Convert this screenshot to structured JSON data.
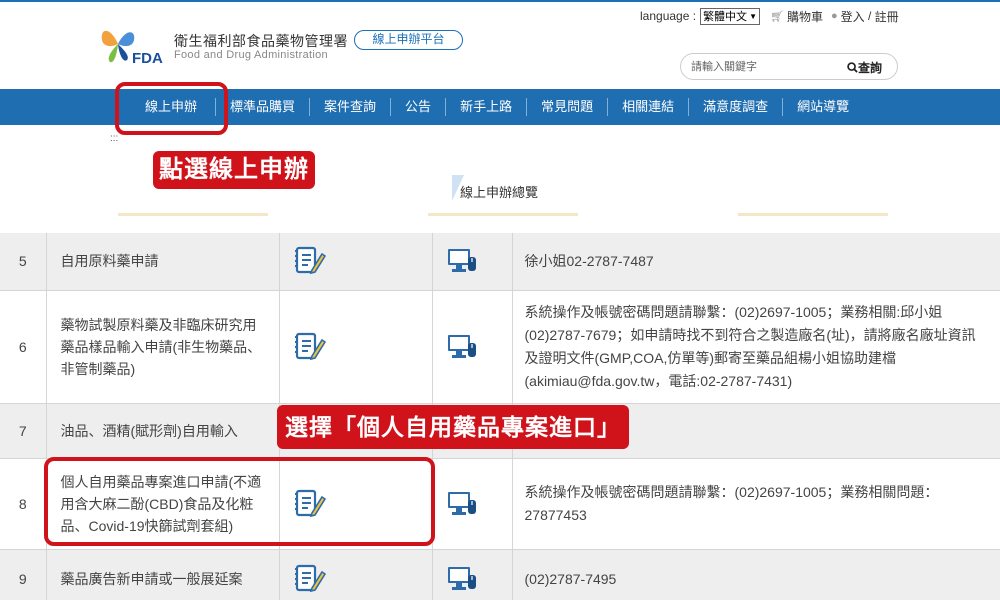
{
  "header": {
    "org_name_cn": "衛生福利部食品藥物管理署",
    "org_name_en": "Food and Drug Administration",
    "logo_text": "FDA",
    "platform_button": "線上申辦平台",
    "language_label": "language :",
    "language_selected": "繁體中文",
    "cart_label": "購物車",
    "login_label": "登入",
    "register_label": "註冊",
    "search_placeholder": "請輸入關鍵字",
    "search_button": "查詢"
  },
  "nav": {
    "items": [
      "線上申辦",
      "標準品購買",
      "案件查詢",
      "公告",
      "新手上路",
      "常見問題",
      "相關連結",
      "滿意度調查",
      "網站導覽"
    ]
  },
  "annotations": {
    "callout_top": "點選線上申辦",
    "callout_mid": "選擇「個人自用藥品專案進口」"
  },
  "breadcrumb": {
    "dots": ":::"
  },
  "section_title": "線上申辦總覽",
  "table": {
    "rows": [
      {
        "num": "5",
        "name": "自用原料藥申請",
        "contact": "徐小姐02-2787-7487",
        "style": "alt"
      },
      {
        "num": "6",
        "name": "藥物試製原料藥及非臨床研究用藥品樣品輸入申請(非生物藥品、非管制藥品)",
        "contact": "系統操作及帳號密碼問題請聯繫：(02)2697-1005；業務相關:邱小姐(02)2787-7679；如申請時找不到符合之製造廠名(址)，請將廠名廠址資訊及證明文件(GMP,COA,仿單等)郵寄至藥品組楊小姐協助建檔(akimiau@fda.gov.tw，電話:02-2787-7431)",
        "style": "plain"
      },
      {
        "num": "7",
        "name": "油品、酒精(賦形劑)自用輸入",
        "contact": "",
        "style": "alt"
      },
      {
        "num": "8",
        "name": "個人自用藥品專案進口申請(不適用含大麻二酚(CBD)食品及化粧品、Covid-19快篩試劑套組)",
        "contact": "系統操作及帳號密碼問題請聯繫：(02)2697-1005；業務相關問題：27877453",
        "style": "plain"
      },
      {
        "num": "9",
        "name": "藥品廣告新申請或一般展延案",
        "contact": "(02)2787-7495",
        "style": "alt"
      }
    ]
  },
  "colors": {
    "nav_bg": "#1f6eb2",
    "highlight_red": "#d0121b",
    "row_alt": "#eeeeee"
  }
}
